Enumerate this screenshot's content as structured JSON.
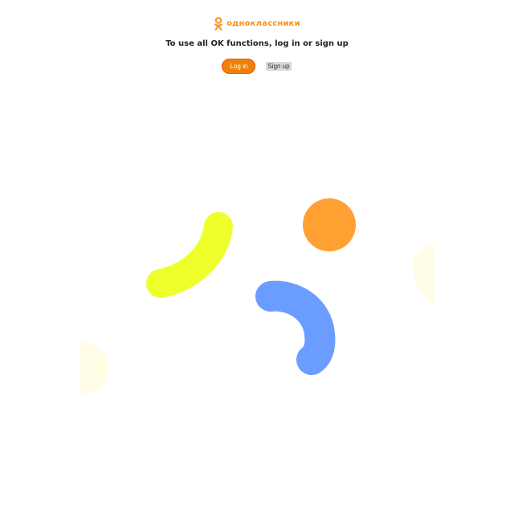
{
  "brand": {
    "name": "одноклассники",
    "icon": "ok-logo-icon",
    "color": "#f7931e"
  },
  "prompt": {
    "text": "To use all OK functions, log in or sign up"
  },
  "actions": {
    "login_label": "Log in",
    "signup_label": "Sign up",
    "login_color": "#ee8208",
    "signup_color": "#d9d9d9"
  },
  "decor": {
    "yellow": "#eeff2b",
    "orange": "#ffa033",
    "blue": "#6b9cff",
    "pale": "#fffde6"
  }
}
